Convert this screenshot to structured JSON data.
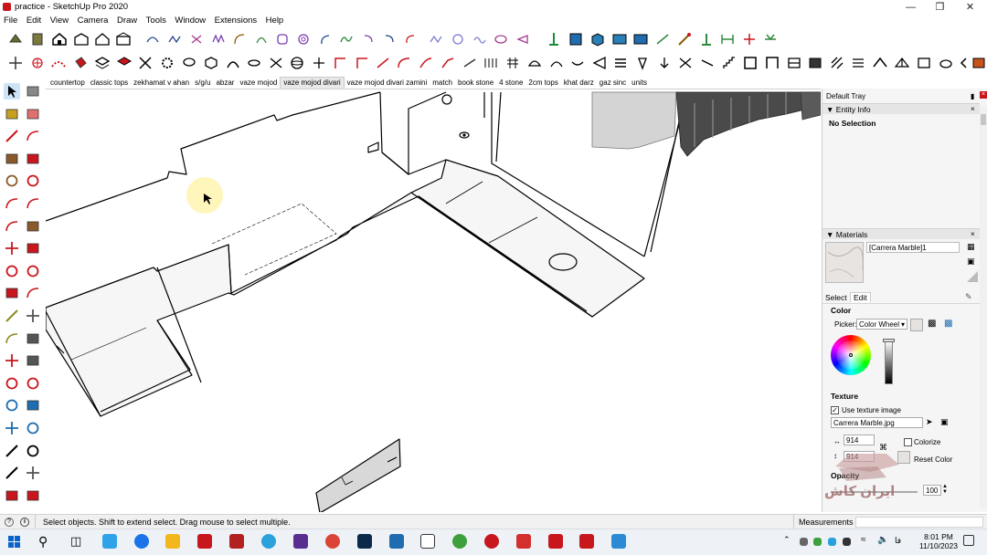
{
  "window": {
    "title": "practice - SketchUp Pro 2020"
  },
  "menu": [
    "File",
    "Edit",
    "View",
    "Camera",
    "Draw",
    "Tools",
    "Window",
    "Extensions",
    "Help"
  ],
  "scenes": [
    "countertop",
    "classic tops",
    "zekhamat v ahan",
    "s/g/u",
    "abzar",
    "vaze mojod",
    "vaze mojod divari",
    "vaze mojod divari zamini",
    "match",
    "book stone",
    "4 stone",
    "2cm tops",
    "khat darz",
    "gaz sinc",
    "units"
  ],
  "active_scene": "vaze mojod divari",
  "tray": {
    "title": "Default Tray",
    "entity_info": {
      "header": "Entity Info",
      "status": "No Selection"
    },
    "materials": {
      "header": "Materials",
      "name": "[Carrera Marble]1",
      "tabs": [
        "Select",
        "Edit"
      ],
      "color_label": "Color",
      "picker_label": "Picker:",
      "picker_value": "Color Wheel",
      "texture_label": "Texture",
      "use_texture_label": "Use texture image",
      "texture_file": "Carrera Marble.jpg",
      "width": "914",
      "height": "914",
      "colorize_label": "Colorize",
      "reset_color_label": "Reset Color",
      "opacity_label": "Opacity",
      "opacity_value": "100"
    }
  },
  "status": {
    "hint": "Select objects. Shift to extend select. Drag mouse to select multiple.",
    "measurements_label": "Measurements"
  },
  "taskbar": {
    "time": "8:01 PM",
    "date": "11/10/2023",
    "lang": "فا"
  },
  "watermark": "ایران کاش",
  "colors": {
    "sketchup_red": "#c8161d",
    "accent_blue": "#0a64c8",
    "taskbar_bg": "#eef2f7"
  }
}
